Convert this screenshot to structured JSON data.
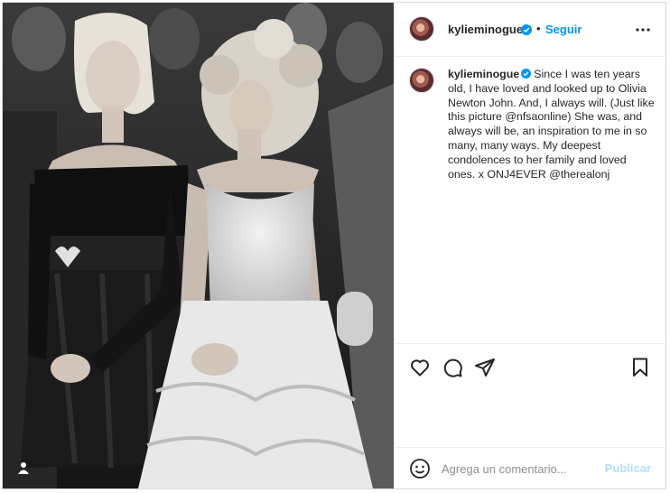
{
  "post": {
    "photo_alt": "kylieminogue post photo",
    "user_tag_icon": "person-tag-icon"
  },
  "header": {
    "username": "kylieminogue",
    "verified_icon": "verified-badge-icon",
    "separator": "•",
    "follow_label": "Seguir",
    "more_icon": "more-options-icon"
  },
  "caption": {
    "username": "kylieminogue",
    "text": "Since I was ten years old, I have loved and looked up to Olivia Newton John. And, I always will. (Just like this picture @nfsaonline) She was, and always will be, an inspiration to me in so many, many ways. My deepest condolences to her family and loved ones. x ONJ4EVER @therealonj"
  },
  "actions": {
    "like_icon": "heart-icon",
    "comment_icon": "comment-icon",
    "share_icon": "send-icon",
    "save_icon": "bookmark-icon"
  },
  "add_comment": {
    "emoji_icon": "emoji-icon",
    "placeholder": "Agrega un comentario...",
    "publish_label": "Publicar"
  },
  "colors": {
    "accent": "#0095f6",
    "publish_disabled": "#b2dffc",
    "border": "#dbdbdb",
    "text": "#262626",
    "muted": "#8e8e8e"
  }
}
